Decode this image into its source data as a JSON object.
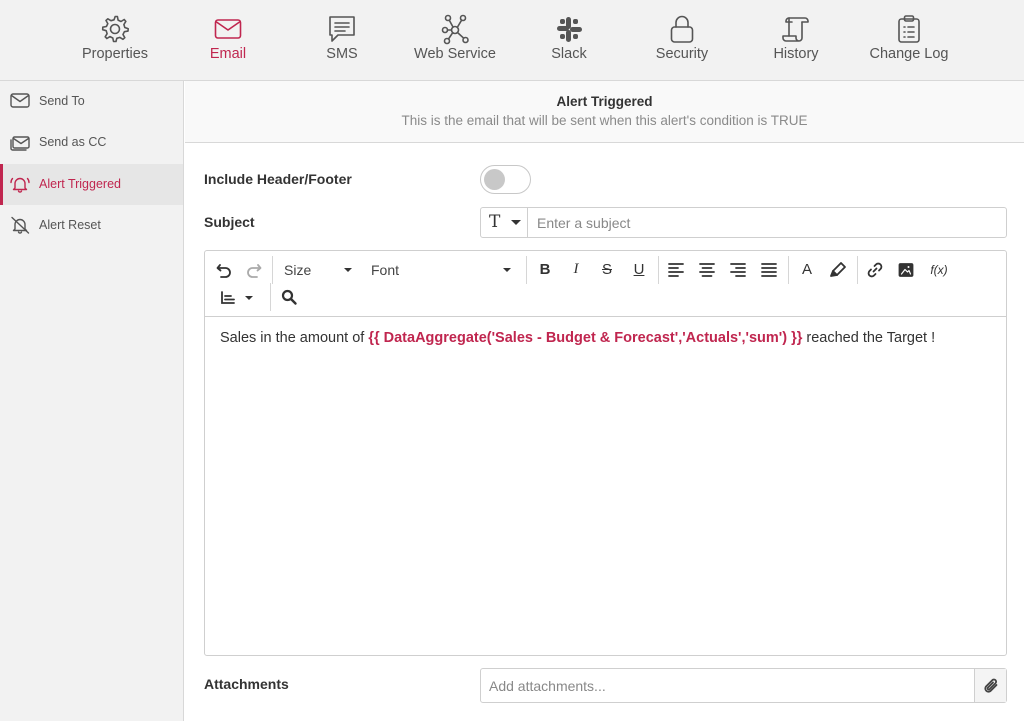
{
  "topnav": {
    "items": [
      {
        "label": "Properties",
        "icon": "gear-icon",
        "active": false
      },
      {
        "label": "Email",
        "icon": "envelope-icon",
        "active": true
      },
      {
        "label": "SMS",
        "icon": "message-icon",
        "active": false
      },
      {
        "label": "Web Service",
        "icon": "network-icon",
        "active": false
      },
      {
        "label": "Slack",
        "icon": "slack-icon",
        "active": false
      },
      {
        "label": "Security",
        "icon": "lock-icon",
        "active": false
      },
      {
        "label": "History",
        "icon": "scroll-icon",
        "active": false
      },
      {
        "label": "Change Log",
        "icon": "clipboard-icon",
        "active": false
      }
    ]
  },
  "sidebar": {
    "items": [
      {
        "label": "Send To",
        "icon": "envelope-icon",
        "active": false
      },
      {
        "label": "Send as CC",
        "icon": "envelopes-icon",
        "active": false
      },
      {
        "label": "Alert Triggered",
        "icon": "bell-ringing-icon",
        "active": true
      },
      {
        "label": "Alert Reset",
        "icon": "bell-off-icon",
        "active": false
      }
    ]
  },
  "header": {
    "title": "Alert Triggered",
    "subtitle": "This is the email that will be sent when this alert's condition is TRUE"
  },
  "form": {
    "header_footer_label": "Include Header/Footer",
    "header_footer_enabled": false,
    "subject_label": "Subject",
    "subject_type_glyph": "T",
    "subject_placeholder": "Enter a subject",
    "subject_value": "",
    "attachments_label": "Attachments",
    "attachments_placeholder": "Add attachments..."
  },
  "editor": {
    "toolbar": {
      "size_label": "Size",
      "font_label": "Font",
      "bold_glyph": "B",
      "italic_glyph": "I",
      "strike_glyph": "S",
      "underline_glyph": "U",
      "font_color_glyph": "A",
      "formula_glyph": "f(x)"
    },
    "content": {
      "before": "Sales in the amount of ",
      "expression": "{{ DataAggregate('Sales - Budget & Forecast','Actuals','sum') }}",
      "after": " reached the Target !"
    }
  },
  "colors": {
    "accent": "#c0264f",
    "nav_background": "#f2f2f2",
    "text": "#333333",
    "muted_text": "#8a8a8a",
    "border": "#cfcfcf"
  }
}
